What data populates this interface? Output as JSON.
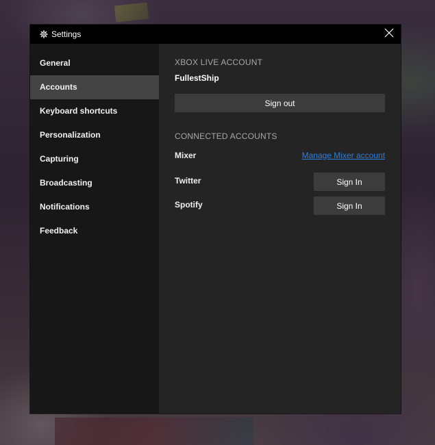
{
  "window": {
    "title": "Settings",
    "title_icon": "gear-icon",
    "close_icon": "close-icon"
  },
  "sidebar": {
    "items": [
      {
        "label": "General",
        "active": false
      },
      {
        "label": "Accounts",
        "active": true
      },
      {
        "label": "Keyboard shortcuts",
        "active": false
      },
      {
        "label": "Personalization",
        "active": false
      },
      {
        "label": "Capturing",
        "active": false
      },
      {
        "label": "Broadcasting",
        "active": false
      },
      {
        "label": "Notifications",
        "active": false
      },
      {
        "label": "Feedback",
        "active": false
      }
    ]
  },
  "xbox_account": {
    "header": "XBOX LIVE ACCOUNT",
    "gamertag": "FullestShip",
    "signout_label": "Sign out"
  },
  "connected": {
    "header": "CONNECTED ACCOUNTS",
    "accounts": [
      {
        "name": "Mixer",
        "action": "Manage Mixer account"
      },
      {
        "name": "Twitter",
        "action": "Sign In"
      },
      {
        "name": "Spotify",
        "action": "Sign In"
      }
    ]
  },
  "colors": {
    "link": "#2f7fd6",
    "active_nav": "#444444",
    "button_bg": "#3c3c3c"
  }
}
